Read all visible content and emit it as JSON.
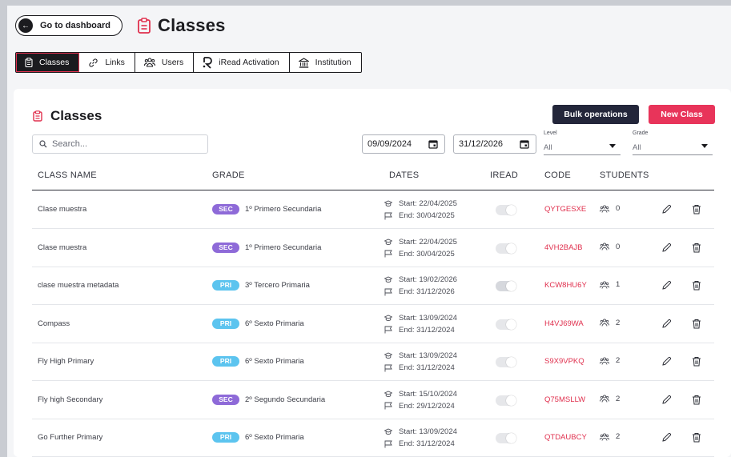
{
  "header": {
    "back_label": "Go to dashboard",
    "title": "Classes",
    "title_icon": "clipboard-icon",
    "accent": "#e0304e"
  },
  "tabs": [
    {
      "label": "Classes",
      "icon": "clipboard-icon",
      "active": true
    },
    {
      "label": "Links",
      "icon": "link-icon",
      "active": false
    },
    {
      "label": "Users",
      "icon": "users-icon",
      "active": false
    },
    {
      "label": "iRead Activation",
      "icon": "iread-logo-icon",
      "active": false
    },
    {
      "label": "Institution",
      "icon": "institution-icon",
      "active": false
    }
  ],
  "card": {
    "title": "Classes",
    "bulk_label": "Bulk operations",
    "new_label": "New Class",
    "search_placeholder": "Search...",
    "start_date": "09/09/2024",
    "end_date": "31/12/2026",
    "level": {
      "label": "Level",
      "value": "All"
    },
    "grade": {
      "label": "Grade",
      "value": "All"
    }
  },
  "columns": [
    "CLASS NAME",
    "GRADE",
    "DATES",
    "IREAD",
    "CODE",
    "STUDENTS"
  ],
  "rows": [
    {
      "name": "Clase muestra",
      "badge": "SEC",
      "grade": "1º Primero Secundaria",
      "start": "Start: 22/04/2025",
      "end": "End: 30/04/2025",
      "iread": false,
      "code": "QYTGESXE",
      "students": "0"
    },
    {
      "name": "Clase muestra",
      "badge": "SEC",
      "grade": "1º Primero Secundaria",
      "start": "Start: 22/04/2025",
      "end": "End: 30/04/2025",
      "iread": false,
      "code": "4VH2BAJB",
      "students": "0"
    },
    {
      "name": "clase muestra metadata",
      "badge": "PRI",
      "grade": "3º Tercero Primaria",
      "start": "Start: 19/02/2026",
      "end": "End: 31/12/2026",
      "iread": false,
      "code": "KCW8HU6Y",
      "students": "1"
    },
    {
      "name": "Compass",
      "badge": "PRI",
      "grade": "6º Sexto Primaria",
      "start": "Start: 13/09/2024",
      "end": "End: 31/12/2024",
      "iread": false,
      "code": "H4VJ69WA",
      "students": "2"
    },
    {
      "name": "Fly High Primary",
      "badge": "PRI",
      "grade": "6º Sexto Primaria",
      "start": "Start: 13/09/2024",
      "end": "End: 31/12/2024",
      "iread": false,
      "code": "S9X9VPKQ",
      "students": "2"
    },
    {
      "name": "Fly high Secondary",
      "badge": "SEC",
      "grade": "2º Segundo Secundaria",
      "start": "Start: 15/10/2024",
      "end": "End: 29/12/2024",
      "iread": false,
      "code": "Q75MSLLW",
      "students": "2"
    },
    {
      "name": "Go Further Primary",
      "badge": "PRI",
      "grade": "6º Sexto Primaria",
      "start": "Start: 13/09/2024",
      "end": "End: 31/12/2024",
      "iread": false,
      "code": "QTDAUBCY",
      "students": "2"
    }
  ]
}
